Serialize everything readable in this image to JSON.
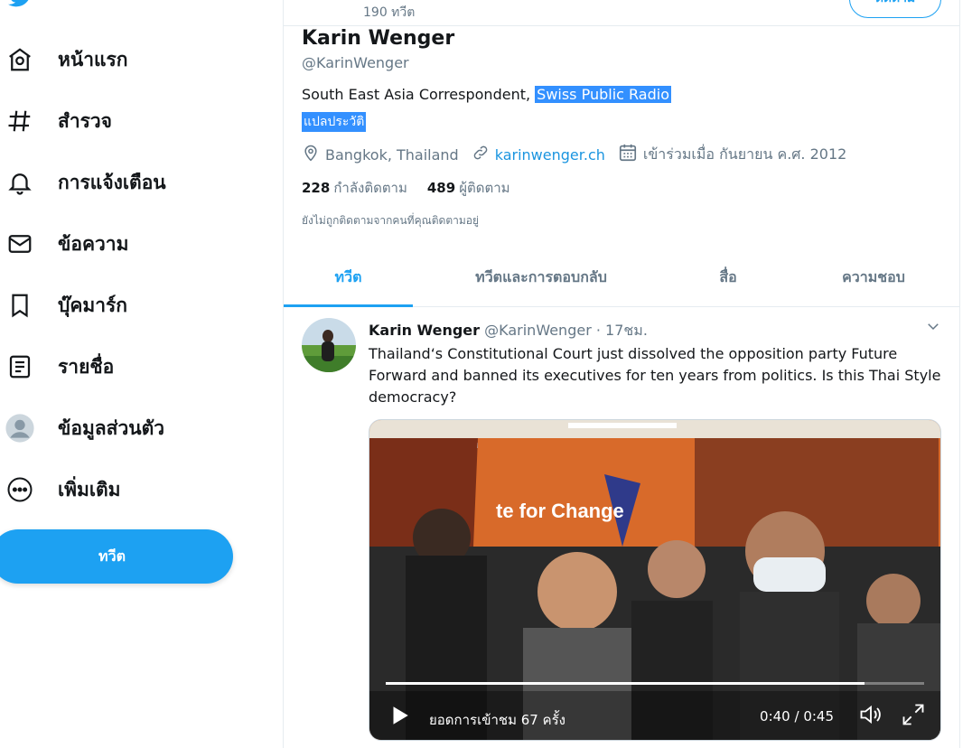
{
  "sidebar": {
    "items": [
      {
        "label": "หน้าแรก",
        "icon": "home-icon"
      },
      {
        "label": "สำรวจ",
        "icon": "hashtag-icon"
      },
      {
        "label": "การแจ้งเตือน",
        "icon": "bell-icon"
      },
      {
        "label": "ข้อความ",
        "icon": "mail-icon"
      },
      {
        "label": "บุ๊คมาร์ก",
        "icon": "bookmark-icon"
      },
      {
        "label": "รายชื่อ",
        "icon": "list-icon"
      },
      {
        "label": "ข้อมูลส่วนตัว",
        "icon": "avatar-icon"
      },
      {
        "label": "เพิ่มเติม",
        "icon": "more-icon"
      }
    ],
    "tweet_button": "ทวีต"
  },
  "header": {
    "tweet_count": "190 ทวีต",
    "follow_button": "ติดตาม"
  },
  "profile": {
    "name": "Karin Wenger",
    "handle": "@KarinWenger",
    "bio_prefix": "South East Asia Correspondent, ",
    "bio_highlight": "Swiss Public Radio",
    "translate_bio": "แปลประวัติ",
    "location": "Bangkok, Thailand",
    "website": "karinwenger.ch",
    "joined": "เข้าร่วมเมื่อ กันยายน ค.ศ. 2012",
    "following_count": "228",
    "following_label": "กำลังติดตาม",
    "followers_count": "489",
    "followers_label": "ผู้ติดตาม",
    "not_followed_note": "ยังไม่ถูกติดตามจากคนที่คุณติดตามอยู่"
  },
  "tabs": [
    {
      "label": "ทวีต",
      "active": true
    },
    {
      "label": "ทวีตและการตอบกลับ",
      "active": false
    },
    {
      "label": "สื่อ",
      "active": false
    },
    {
      "label": "ความชอบ",
      "active": false
    }
  ],
  "tweet": {
    "name": "Karin Wenger",
    "handle": "@KarinWenger",
    "separator": "·",
    "time": "17ชม.",
    "text": "Thailand‘s Constitutional Court just dissolved the opposition party Future Forward and banned its executives for ten years from politics. Is this Thai Style democracy?",
    "video": {
      "sign_text": "te for Change",
      "views": "ยอดการเข้าชม 67 ครั้ง",
      "elapsed": "0:40",
      "duration": "0:45",
      "time_separator": " / ",
      "progress": 0.89
    }
  },
  "colors": {
    "accent": "#1da1f2",
    "link": "#1b95e0",
    "muted": "#657786",
    "selection": "#3390ff"
  }
}
